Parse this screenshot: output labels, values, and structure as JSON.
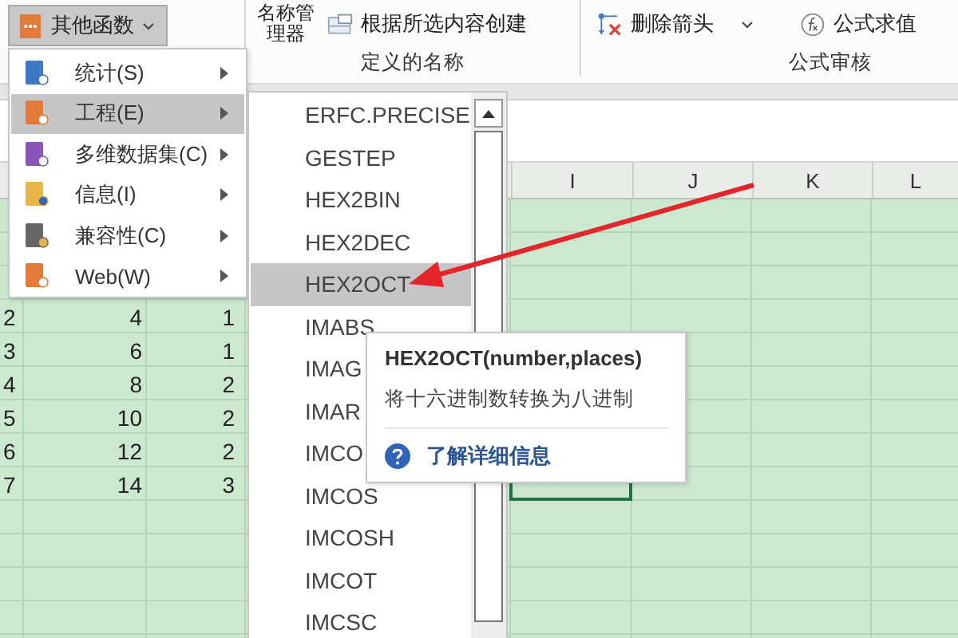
{
  "ribbon": {
    "more_functions": {
      "label": "其他函数",
      "pressed": true
    },
    "groups": [
      {
        "label": "定义的名称",
        "buttons": [
          {
            "label": "名称管理器"
          },
          {
            "label": "根据所选内容创建"
          }
        ]
      },
      {
        "label": "公式审核",
        "buttons": [
          {
            "label": "删除箭头"
          },
          {
            "label": "公式求值"
          }
        ]
      }
    ]
  },
  "sheet": {
    "columns": [
      "I",
      "J",
      "K",
      "L"
    ],
    "rows": [
      {
        "cells": [
          "2",
          "4",
          "1"
        ]
      },
      {
        "cells": [
          "3",
          "6",
          "1"
        ]
      },
      {
        "cells": [
          "4",
          "8",
          "2"
        ]
      },
      {
        "cells": [
          "5",
          "10",
          "2"
        ]
      },
      {
        "cells": [
          "6",
          "12",
          "2"
        ]
      },
      {
        "cells": [
          "7",
          "14",
          "3"
        ]
      }
    ]
  },
  "menu": {
    "items": [
      {
        "label": "统计(S)",
        "selected": false
      },
      {
        "label": "工程(E)",
        "selected": true
      },
      {
        "label": "多维数据集(C)",
        "selected": false
      },
      {
        "label": "信息(I)",
        "selected": false
      },
      {
        "label": "兼容性(C)",
        "selected": false
      },
      {
        "label": "Web(W)",
        "selected": false
      }
    ]
  },
  "submenu": {
    "items": [
      {
        "label": "ERFC.PRECISE",
        "selected": false
      },
      {
        "label": "GESTEP",
        "selected": false
      },
      {
        "label": "HEX2BIN",
        "selected": false
      },
      {
        "label": "HEX2DEC",
        "selected": false
      },
      {
        "label": "HEX2OCT",
        "selected": true
      },
      {
        "label": "IMABS",
        "selected": false
      },
      {
        "label": "IMAG",
        "selected": false
      },
      {
        "label": "IMAR",
        "selected": false
      },
      {
        "label": "IMCO",
        "selected": false
      },
      {
        "label": "IMCOS",
        "selected": false
      },
      {
        "label": "IMCOSH",
        "selected": false
      },
      {
        "label": "IMCOT",
        "selected": false
      },
      {
        "label": "IMCSC",
        "selected": false
      }
    ]
  },
  "tooltip": {
    "title": "HEX2OCT(number,places)",
    "description": "将十六进制数转换为八进制",
    "link": "了解详细信息"
  }
}
